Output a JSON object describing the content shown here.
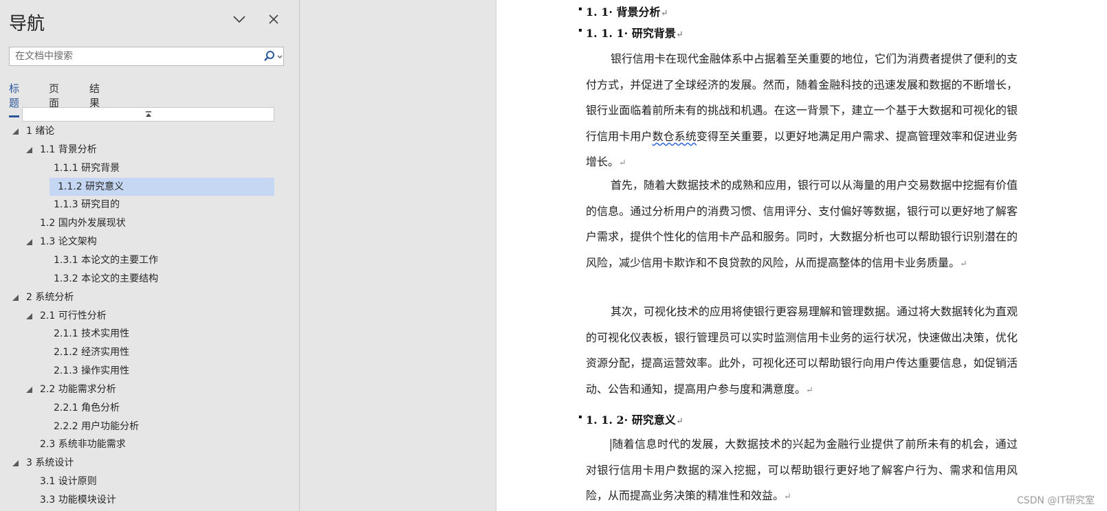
{
  "nav": {
    "title": "导航",
    "search_placeholder": "在文档中搜索",
    "search_value": "",
    "tabs": [
      {
        "label": "标题",
        "active": true
      },
      {
        "label": "页面",
        "active": false
      },
      {
        "label": "结果",
        "active": false
      }
    ],
    "tree": [
      {
        "label": "1 绪论",
        "level": 0,
        "expanded": true,
        "selected": false
      },
      {
        "label": "1.1 背景分析",
        "level": 1,
        "expanded": true,
        "selected": false
      },
      {
        "label": "1.1.1 研究背景",
        "level": 2,
        "expanded": null,
        "selected": false
      },
      {
        "label": "1.1.2 研究意义",
        "level": 2,
        "expanded": null,
        "selected": true
      },
      {
        "label": "1.1.3 研究目的",
        "level": 2,
        "expanded": null,
        "selected": false
      },
      {
        "label": "1.2 国内外发展现状",
        "level": 1,
        "expanded": null,
        "selected": false
      },
      {
        "label": "1.3 论文架构",
        "level": 1,
        "expanded": true,
        "selected": false
      },
      {
        "label": "1.3.1 本论文的主要工作",
        "level": 2,
        "expanded": null,
        "selected": false
      },
      {
        "label": "1.3.2 本论文的主要结构",
        "level": 2,
        "expanded": null,
        "selected": false
      },
      {
        "label": "2 系统分析",
        "level": 0,
        "expanded": true,
        "selected": false
      },
      {
        "label": "2.1 可行性分析",
        "level": 1,
        "expanded": true,
        "selected": false
      },
      {
        "label": "2.1.1 技术实用性",
        "level": 2,
        "expanded": null,
        "selected": false
      },
      {
        "label": "2.1.2 经济实用性",
        "level": 2,
        "expanded": null,
        "selected": false
      },
      {
        "label": "2.1.3 操作实用性",
        "level": 2,
        "expanded": null,
        "selected": false
      },
      {
        "label": "2.2 功能需求分析",
        "level": 1,
        "expanded": true,
        "selected": false
      },
      {
        "label": "2.2.1 角色分析",
        "level": 2,
        "expanded": null,
        "selected": false
      },
      {
        "label": "2.2.2 用户功能分析",
        "level": 2,
        "expanded": null,
        "selected": false
      },
      {
        "label": "2.3 系统非功能需求",
        "level": 1,
        "expanded": null,
        "selected": false
      },
      {
        "label": "3 系统设计",
        "level": 0,
        "expanded": true,
        "selected": false
      },
      {
        "label": "3.1 设计原则",
        "level": 1,
        "expanded": null,
        "selected": false
      },
      {
        "label": "3.3 功能模块设计",
        "level": 1,
        "expanded": null,
        "selected": false
      }
    ]
  },
  "document": {
    "heading_1_1": "1. 1· 背景分析",
    "heading_1_1_1": "1. 1. 1· 研究背景",
    "para1_before": "银行信用卡在现代金融体系中占据着至关重要的地位，它们为消费者提供了便利的支付方式，并促进了全球经济的发展。然而，随着金融科技的迅速发展和数据的不断增长，银行业面临着前所未有的挑战和机遇。在这一背景下，建立一个基于大数据和可视化的银行信用卡用户",
    "para1_flagged": "数仓系统",
    "para1_after": "变得至关重要，以更好地满足用户需求、提高管理效率和促进业务增长。",
    "para2": "首先，随着大数据技术的成熟和应用，银行可以从海量的用户交易数据中挖掘有价值的信息。通过分析用户的消费习惯、信用评分、支付偏好等数据，银行可以更好地了解客户需求，提供个性化的信用卡产品和服务。同时，大数据分析也可以帮助银行识别潜在的风险，减少信用卡欺诈和不良贷款的风险，从而提高整体的信用卡业务质量。",
    "para3": "其次，可视化技术的应用将使银行更容易理解和管理数据。通过将大数据转化为直观的可视化仪表板，银行管理员可以实时监测信用卡业务的运行状况，快速做出决策，优化资源分配，提高运营效率。此外，可视化还可以帮助银行向用户传达重要信息，如促销活动、公告和通知，提高用户参与度和满意度。",
    "heading_1_1_2": "1. 1. 2· 研究意义",
    "para4": "随着信息时代的发展，大数据技术的兴起为金融行业提供了前所未有的机会，通过对银行信用卡用户数据的深入挖掘，可以帮助银行更好地了解客户行为、需求和信用风险，从而提高业务决策的精准性和效益。",
    "para_mark": "↵",
    "watermark": "CSDN @IT研究室"
  }
}
